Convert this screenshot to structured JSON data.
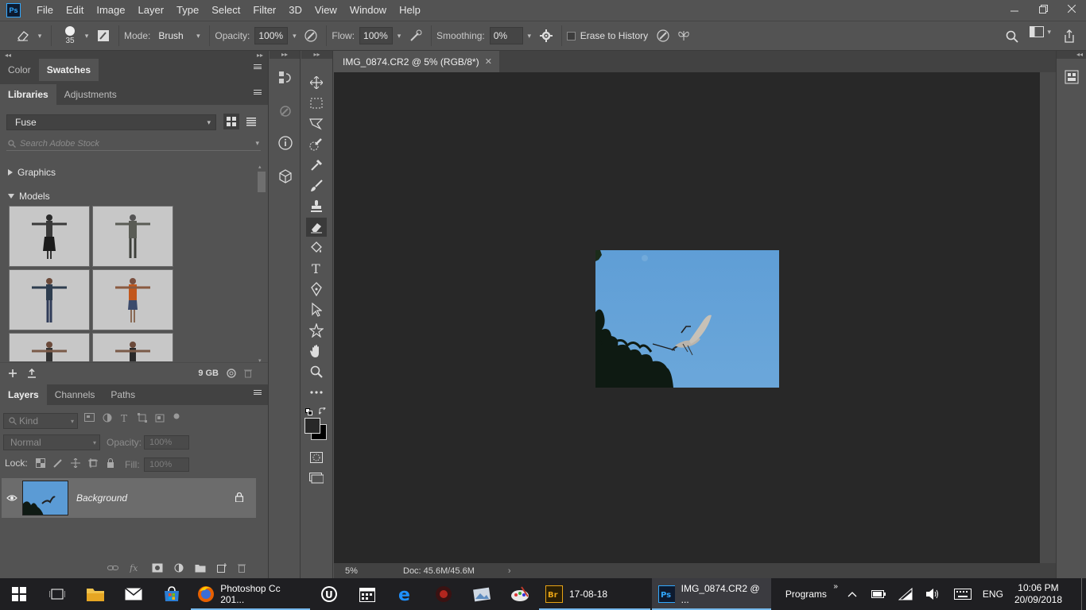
{
  "app": {
    "logo_text": "Ps",
    "menu": [
      "File",
      "Edit",
      "Image",
      "Layer",
      "Type",
      "Select",
      "Filter",
      "3D",
      "View",
      "Window",
      "Help"
    ],
    "window_controls": [
      "minimize",
      "restore",
      "close"
    ]
  },
  "options_bar": {
    "brush_size": "35",
    "mode_label": "Mode:",
    "mode_value": "Brush",
    "opacity_label": "Opacity:",
    "opacity_value": "100%",
    "flow_label": "Flow:",
    "flow_value": "100%",
    "smoothing_label": "Smoothing:",
    "smoothing_value": "0%",
    "erase_to_history_label": "Erase to History",
    "erase_to_history_checked": false
  },
  "color_panel": {
    "tabs": [
      "Color",
      "Swatches"
    ],
    "active_tab": "Swatches"
  },
  "libraries_panel": {
    "tabs": [
      "Libraries",
      "Adjustments"
    ],
    "active_tab": "Libraries",
    "library_selected": "Fuse",
    "search_placeholder": "Search Adobe Stock",
    "sections": [
      {
        "label": "Graphics",
        "expanded": false
      },
      {
        "label": "Models",
        "expanded": true
      }
    ],
    "storage": "9 GB"
  },
  "layers_panel": {
    "tabs": [
      "Layers",
      "Channels",
      "Paths"
    ],
    "active_tab": "Layers",
    "filter_kind": "Kind",
    "blend_mode": "Normal",
    "opacity_label": "Opacity:",
    "opacity_value": "100%",
    "lock_label": "Lock:",
    "fill_label": "Fill:",
    "fill_value": "100%",
    "layers": [
      {
        "name": "Background",
        "visible": true,
        "locked": true
      }
    ]
  },
  "document": {
    "tab_title": "IMG_0874.CR2 @ 5% (RGB/8*)",
    "zoom": "5%",
    "doc_size": "Doc: 45.6M/45.6M"
  },
  "taskbar": {
    "items": [
      {
        "label": "Photoshop Cc 201...",
        "icon": "firefox-icon"
      },
      {
        "label": "17-08-18",
        "icon": "bridge-icon"
      },
      {
        "label": "IMG_0874.CR2 @ ...",
        "icon": "photoshop-icon",
        "active": true
      }
    ],
    "programs_label": "Programs",
    "language": "ENG",
    "time": "10:06 PM",
    "date": "20/09/2018"
  },
  "colors": {
    "ui_bg": "#535353",
    "panel_dark": "#424242",
    "canvas_bg": "#282828",
    "sky_blue": "#5b9bd5",
    "accent": "#31a8ff"
  }
}
